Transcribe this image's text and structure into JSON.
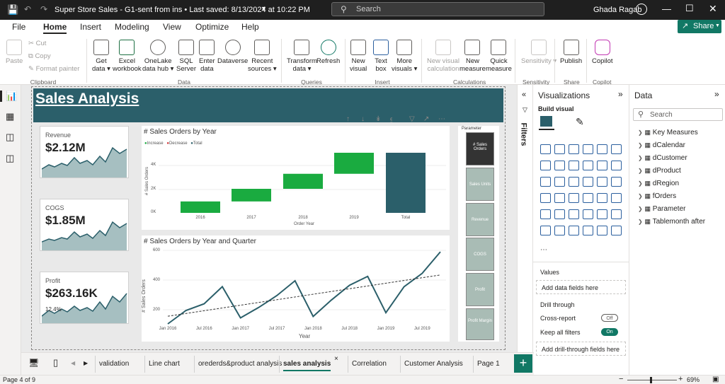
{
  "titlebar": {
    "document": "Super Store Sales - G1-sent from ins • Last saved: 8/13/2024 at 10:22 PM",
    "search": "Search",
    "user": "Ghada Ragab"
  },
  "menu": {
    "file": "File",
    "home": "Home",
    "insert": "Insert",
    "modeling": "Modeling",
    "view": "View",
    "optimize": "Optimize",
    "help": "Help",
    "share": "Share"
  },
  "ribbon": {
    "paste": "Paste",
    "cut": "Cut",
    "copy": "Copy",
    "format_painter": "Format painter",
    "clipboard": "Clipboard",
    "get_data": [
      "Get",
      "data"
    ],
    "excel": [
      "Excel",
      "workbook"
    ],
    "onelake": [
      "OneLake",
      "data hub"
    ],
    "sql": [
      "SQL",
      "Server"
    ],
    "enter_data": [
      "Enter",
      "data"
    ],
    "dataverse": "Dataverse",
    "recent": [
      "Recent",
      "sources"
    ],
    "data_group": "Data",
    "transform": [
      "Transform",
      "data"
    ],
    "refresh": "Refresh",
    "queries": "Queries",
    "new_visual": [
      "New",
      "visual"
    ],
    "text_box": [
      "Text",
      "box"
    ],
    "more_visuals": [
      "More",
      "visuals"
    ],
    "insert_group": "Insert",
    "new_visual_calc": [
      "New visual",
      "calculation"
    ],
    "new_measure": [
      "New",
      "measure"
    ],
    "quick_measure": [
      "Quick",
      "measure"
    ],
    "calculations": "Calculations",
    "sensitivity": "Sensitivity",
    "sensitivity_group": "Sensitivity",
    "publish": "Publish",
    "share_group": "Share",
    "copilot": "Copilot",
    "copilot_group": "Copilot"
  },
  "report": {
    "title": "Sales Analysis",
    "kpis": [
      {
        "label": "Revenue",
        "value": "$2.12M"
      },
      {
        "label": "COGS",
        "value": "$1.85M"
      },
      {
        "label": "Profit",
        "value": "$263.16K",
        "extra": "12.4%"
      }
    ],
    "waterfall": {
      "title": "# Sales Orders by Year",
      "legend": [
        "Increase",
        "Decrease",
        "Total"
      ],
      "ylabel": "# Sales Orders",
      "xlabel": "Order Year",
      "yticks": [
        "4K",
        "2K",
        "0K"
      ]
    },
    "linechart": {
      "title": "# Sales Orders by Year and Quarter",
      "ylabel": "# Sales Orders",
      "xlabel": "Year",
      "yticks": [
        "600",
        "400",
        "200"
      ]
    },
    "parameter": {
      "title": "Parameter",
      "items": [
        "# Sales Orders",
        "Sales Units",
        "Revenue",
        "COGS",
        "Profit",
        "Profit Margin"
      ]
    }
  },
  "chart_data": [
    {
      "type": "bar",
      "title": "# Sales Orders by Year",
      "xlabel": "Order Year",
      "ylabel": "# Sales Orders",
      "categories": [
        "2016",
        "2017",
        "2018",
        "2019",
        "Total"
      ],
      "series": [
        {
          "name": "Increase",
          "values": [
            950,
            1050,
            1250,
            1750
          ]
        },
        {
          "name": "Total",
          "values": [
            5000
          ]
        }
      ],
      "ylim": [
        0,
        5500
      ]
    },
    {
      "type": "line",
      "title": "# Sales Orders by Year and Quarter",
      "xlabel": "Year",
      "ylabel": "# Sales Orders",
      "x": [
        "2016 Q1",
        "2016 Q2",
        "2016 Q3",
        "2016 Q4",
        "2017 Q1",
        "2017 Q2",
        "2017 Q3",
        "2017 Q4",
        "2018 Q1",
        "2018 Q2",
        "2018 Q3",
        "2018 Q4",
        "2019 Q1",
        "2019 Q2",
        "2019 Q3",
        "2019 Q4"
      ],
      "x_tick_labels": [
        "Jan 2016",
        "Jul 2016",
        "Jan 2017",
        "Jul 2017",
        "Jan 2018",
        "Jul 2018",
        "Jan 2019",
        "Jul 2019"
      ],
      "series": [
        {
          "values": [
            105,
            195,
            240,
            355,
            145,
            215,
            295,
            395,
            155,
            265,
            365,
            425,
            180,
            355,
            445,
            590
          ]
        }
      ],
      "trendline": true,
      "ylim": [
        100,
        620
      ]
    }
  ],
  "filters": {
    "label": "Filters"
  },
  "visualizations": {
    "title": "Visualizations",
    "build_visual": "Build visual",
    "values": "Values",
    "add_data": "Add data fields here",
    "drill_through": "Drill through",
    "cross_report": "Cross-report",
    "cross_state": "Off",
    "keep_filters": "Keep all filters",
    "keep_state": "On",
    "add_drill": "Add drill-through fields here"
  },
  "data": {
    "title": "Data",
    "search": "Search",
    "fields": [
      "Key Measures",
      "dCalendar",
      "dCustomer",
      "dProduct",
      "dRegion",
      "fOrders",
      "Parameter",
      "Tablemonth after"
    ]
  },
  "tabs": [
    "validation",
    "Line chart",
    "orederds&product analysis",
    "sales analysis",
    "Correlation",
    "Customer Analysis",
    "Page 1"
  ],
  "status": {
    "page": "Page 4 of 9",
    "zoom": "69%"
  }
}
